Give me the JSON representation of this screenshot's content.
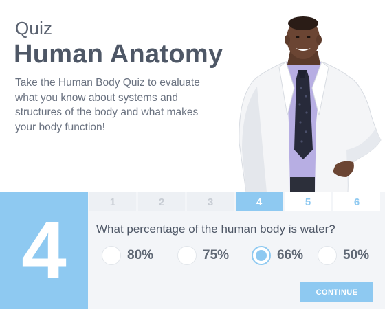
{
  "header": {
    "kicker": "Quiz",
    "title": "Human Anatomy",
    "description": "Take the Human Body Quiz to evaluate what you know about systems and structures of the body and what makes your body function!"
  },
  "quiz": {
    "current_number": "4",
    "steps": [
      {
        "label": "1",
        "state": "past"
      },
      {
        "label": "2",
        "state": "past"
      },
      {
        "label": "3",
        "state": "past"
      },
      {
        "label": "4",
        "state": "current"
      },
      {
        "label": "5",
        "state": "future"
      },
      {
        "label": "6",
        "state": "future"
      }
    ],
    "question": "What percentage of the human body is water?",
    "options": [
      {
        "label": "80%",
        "selected": false
      },
      {
        "label": "75%",
        "selected": false
      },
      {
        "label": "66%",
        "selected": true
      },
      {
        "label": "50%",
        "selected": false
      }
    ],
    "continue_label": "CONTINUE"
  },
  "colors": {
    "accent": "#8ec9f1",
    "heading": "#4e5766",
    "body_text": "#6a7280"
  },
  "icons": {
    "doctor": "doctor-photo",
    "radio": "radio-button"
  }
}
